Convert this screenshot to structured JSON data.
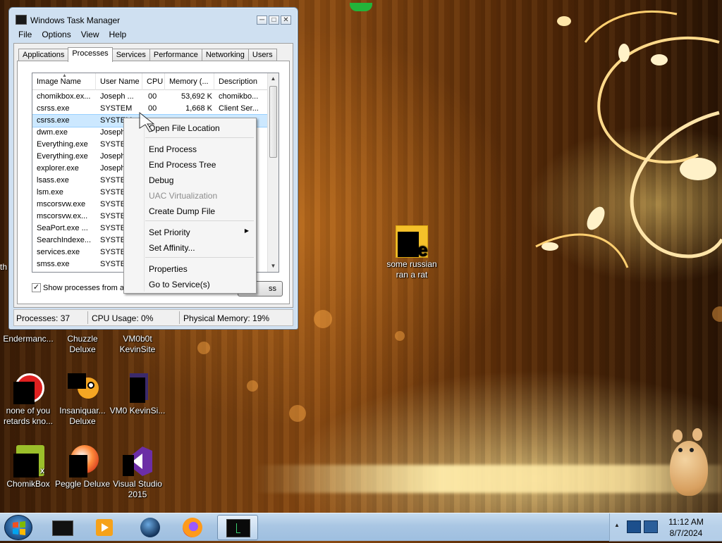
{
  "task_manager": {
    "title": "Windows Task Manager",
    "menu": [
      "File",
      "Options",
      "View",
      "Help"
    ],
    "window_controls": {
      "minimize": "─",
      "maximize": "□",
      "close": "✕"
    },
    "tabs": [
      "Applications",
      "Processes",
      "Services",
      "Performance",
      "Networking",
      "Users"
    ],
    "active_tab": "Processes",
    "columns": [
      "Image Name",
      "User Name",
      "CPU",
      "Memory (...",
      "Description"
    ],
    "rows": [
      {
        "name": "chomikbox.ex...",
        "user": "Joseph ...",
        "cpu": "00",
        "mem": "53,692 K",
        "desc": "chomikbo..."
      },
      {
        "name": "csrss.exe",
        "user": "SYSTEM",
        "cpu": "00",
        "mem": "1,668 K",
        "desc": "Client Ser..."
      },
      {
        "name": "csrss.exe",
        "user": "SYSTEM",
        "cpu": "",
        "mem": "",
        "desc": ""
      },
      {
        "name": "dwm.exe",
        "user": "Joseph",
        "cpu": "",
        "mem": "",
        "desc": ""
      },
      {
        "name": "Everything.exe",
        "user": "SYSTEM",
        "cpu": "",
        "mem": "",
        "desc": ""
      },
      {
        "name": "Everything.exe",
        "user": "Joseph",
        "cpu": "",
        "mem": "",
        "desc": ""
      },
      {
        "name": "explorer.exe",
        "user": "Joseph",
        "cpu": "",
        "mem": "",
        "desc": ""
      },
      {
        "name": "lsass.exe",
        "user": "SYSTEM",
        "cpu": "",
        "mem": "",
        "desc": ""
      },
      {
        "name": "lsm.exe",
        "user": "SYSTEM",
        "cpu": "",
        "mem": "",
        "desc": ""
      },
      {
        "name": "mscorsvw.exe",
        "user": "SYSTEM",
        "cpu": "",
        "mem": "",
        "desc": ""
      },
      {
        "name": "mscorsvw.ex...",
        "user": "SYSTEM",
        "cpu": "",
        "mem": "",
        "desc": ""
      },
      {
        "name": "SeaPort.exe ...",
        "user": "SYSTEM",
        "cpu": "",
        "mem": "",
        "desc": ""
      },
      {
        "name": "SearchIndexe...",
        "user": "SYSTEM",
        "cpu": "",
        "mem": "",
        "desc": ""
      },
      {
        "name": "services.exe",
        "user": "SYSTEM",
        "cpu": "",
        "mem": "",
        "desc": ""
      },
      {
        "name": "smss.exe",
        "user": "SYSTEM",
        "cpu": "",
        "mem": "",
        "desc": ""
      }
    ],
    "selected_row": 2,
    "show_all_label": "Show processes from all",
    "show_all_checked": "✓",
    "end_process_fragment": "ss",
    "status": {
      "processes": "Processes: 37",
      "cpu": "CPU Usage: 0%",
      "memory": "Physical Memory: 19%"
    }
  },
  "context_menu": {
    "items": [
      {
        "label": "Open File Location",
        "disabled": false
      },
      {
        "label": "End Process",
        "disabled": false
      },
      {
        "label": "End Process Tree",
        "disabled": false
      },
      {
        "label": "Debug",
        "disabled": false
      },
      {
        "label": "UAC Virtualization",
        "disabled": true
      },
      {
        "label": "Create Dump File",
        "disabled": false
      },
      {
        "label": "Set Priority",
        "disabled": false,
        "submenu": true
      },
      {
        "label": "Set Affinity...",
        "disabled": false
      },
      {
        "label": "Properties",
        "disabled": false
      },
      {
        "label": "Go to Service(s)",
        "disabled": false
      }
    ],
    "submenu_arrow": "▶"
  },
  "desktop": {
    "cutoff_label": "th",
    "icons": [
      {
        "label": "some russian ran a rat",
        "icon": "shortcut-icon"
      },
      {
        "label": "Endermanc...",
        "icon": "hidden-icon"
      },
      {
        "label": "Chuzzle Deluxe",
        "icon": "hidden-icon"
      },
      {
        "label": "VM0b0t KevinSite",
        "icon": "hidden-icon"
      },
      {
        "label": "none of you retards kno...",
        "icon": "red-logo-icon"
      },
      {
        "label": "Insaniquar... Deluxe",
        "icon": "fish-icon"
      },
      {
        "label": "VM0 KevinSi...",
        "icon": "file-icon"
      },
      {
        "label": "ChomikBox",
        "icon": "chomikbox-icon"
      },
      {
        "label": "Peggle Deluxe",
        "icon": "peggle-icon"
      },
      {
        "label": "Visual Studio 2015",
        "icon": "visual-studio-icon"
      }
    ]
  },
  "taskbar": {
    "time": "11:12 AM",
    "date": "8/7/2024",
    "tray_arrow": "▲",
    "colors": {
      "accent": "#1d4f86",
      "taskbar": "#a9c6e3"
    }
  }
}
